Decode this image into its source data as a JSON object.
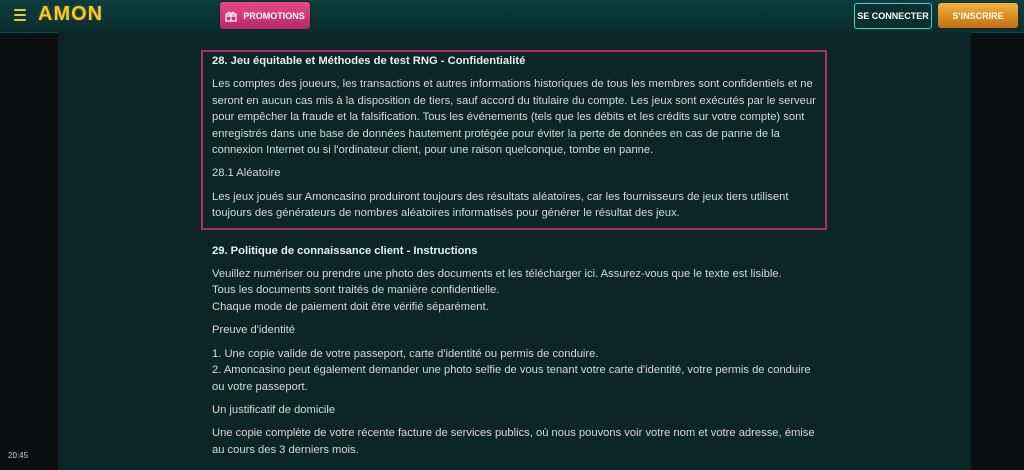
{
  "header": {
    "logo": "AMON",
    "promotions_label": "PROMOTIONS",
    "login_label": "SE CONNECTER",
    "signup_label": "S'INSCRIRE"
  },
  "section28": {
    "title": "28. Jeu équitable et Méthodes de test RNG - Confidentialité",
    "para1": "Les comptes des joueurs, les transactions et autres informations historiques de tous les membres sont confidentiels et ne seront en aucun cas mis à la disposition de tiers, sauf accord du titulaire du compte. Les jeux sont exécutés par le serveur pour empêcher la fraude et la falsification. Tous les événements (tels que les débits et les crédits sur votre compte) sont enregistrés dans une base de données hautement protégée pour éviter la perte de données en cas de panne de la connexion Internet ou si l'ordinateur client, pour une raison quelconque, tombe en panne.",
    "subtitle": "28.1 Aléatoire",
    "para2": "Les jeux joués sur Amoncasino produiront toujours des résultats aléatoires, car les fournisseurs de jeux tiers utilisent toujours des générateurs de nombres aléatoires informatisés pour générer le résultat des jeux."
  },
  "section29": {
    "title": "29. Politique de connaissance client - Instructions",
    "intro_line1": "Veuillez numériser ou prendre une photo des documents et les télécharger ici. Assurez-vous que le texte est lisible.",
    "intro_line2": "Tous les documents sont traités de manière confidentielle.",
    "intro_line3": "Chaque mode de paiement doit être vérifié séparément.",
    "identity_heading": "Preuve d'identité",
    "identity_item1": "1. Une copie valide de votre passeport, carte d'identité ou permis de conduire.",
    "identity_item2": "2. Amoncasino peut également demander une photo selfie de vous tenant votre carte d'identité, votre permis de conduire ou votre passeport.",
    "address_heading": "Un justificatif de domicile",
    "address_text": "Une copie complète de votre récente facture de services publics, où nous pouvons voir votre nom et votre adresse, émise au cours des 3 derniers mois."
  },
  "system": {
    "clock": "20:45"
  },
  "colors": {
    "accent_gold": "#f2c532",
    "promo_pink": "#e84a86",
    "highlight_border": "#b02a6c",
    "login_border": "#3bd7c3"
  }
}
